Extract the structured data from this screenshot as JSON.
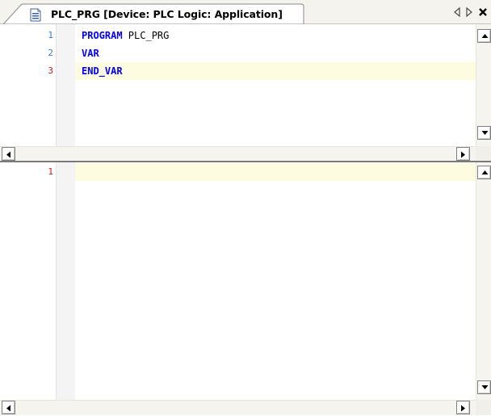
{
  "tab": {
    "title": "PLC_PRG [Device: PLC Logic: Application]",
    "doc_icon": "document-icon",
    "nav_left_icon": "triangle-left-icon",
    "nav_right_icon": "triangle-right-icon",
    "close_icon": "close-icon"
  },
  "declaration_editor": {
    "lines": [
      {
        "number": "1",
        "keyword": "PROGRAM",
        "rest": " PLC_PRG",
        "number_color": "#2f7fd0"
      },
      {
        "number": "2",
        "keyword": "VAR",
        "rest": "",
        "number_color": "#2f7fd0"
      },
      {
        "number": "3",
        "keyword": "END_VAR",
        "rest": "",
        "number_color": "#d01515"
      }
    ],
    "current_line": "3"
  },
  "implementation_editor": {
    "lines": [
      {
        "number": "1",
        "keyword": "",
        "rest": "",
        "number_color": "#d01515"
      }
    ],
    "current_line": "1"
  },
  "colors": {
    "keyword": "#0000ff",
    "current_line_bg": "#fdfbe0",
    "splitter": "#7a7a7a"
  }
}
